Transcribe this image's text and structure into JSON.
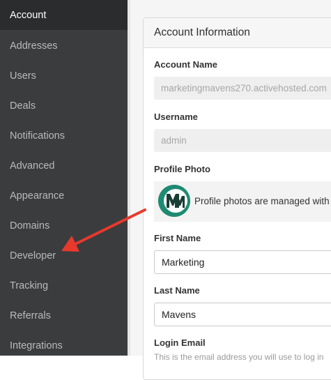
{
  "sidebar": {
    "items": [
      {
        "label": "Account",
        "active": true
      },
      {
        "label": "Addresses"
      },
      {
        "label": "Users"
      },
      {
        "label": "Deals"
      },
      {
        "label": "Notifications"
      },
      {
        "label": "Advanced"
      },
      {
        "label": "Appearance"
      },
      {
        "label": "Domains"
      },
      {
        "label": "Developer"
      },
      {
        "label": "Tracking"
      },
      {
        "label": "Referrals"
      },
      {
        "label": "Integrations"
      }
    ]
  },
  "panel": {
    "title": "Account Information",
    "account_name": {
      "label": "Account Name",
      "value": "marketingmavens270.activehosted.com"
    },
    "username": {
      "label": "Username",
      "value": "admin"
    },
    "profile_photo": {
      "label": "Profile Photo",
      "text": "Profile photos are managed with"
    },
    "first_name": {
      "label": "First Name",
      "value": "Marketing"
    },
    "last_name": {
      "label": "Last Name",
      "value": "Mavens"
    },
    "login_email": {
      "label": "Login Email",
      "help": "This is the email address you will use to log in"
    }
  },
  "colors": {
    "sidebar_bg": "#3b3c3e",
    "sidebar_active_bg": "#2b2c2e",
    "avatar_green": "#1f8a72",
    "arrow_red": "#e8392c"
  },
  "icons": {
    "avatar": "mm-logo-icon",
    "annotation": "red-arrow-icon"
  }
}
